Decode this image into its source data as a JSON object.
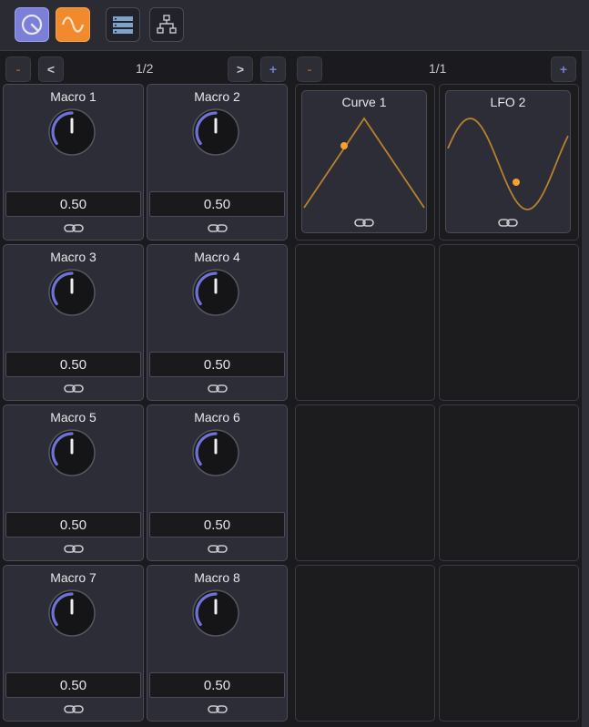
{
  "toolbar": {
    "buttons": [
      {
        "name": "macro-view-button",
        "icon": "knob-icon",
        "active": true
      },
      {
        "name": "lfo-view-button",
        "icon": "wave-icon",
        "active": true
      },
      {
        "name": "list-view-button",
        "icon": "list-icon",
        "active": false
      },
      {
        "name": "tree-view-button",
        "icon": "tree-icon",
        "active": false
      }
    ]
  },
  "macro_panel": {
    "minus": "-",
    "prev": "<",
    "next": ">",
    "plus": "+",
    "page": "1/2",
    "macros": [
      {
        "title": "Macro 1",
        "value": "0.50"
      },
      {
        "title": "Macro 2",
        "value": "0.50"
      },
      {
        "title": "Macro 3",
        "value": "0.50"
      },
      {
        "title": "Macro 4",
        "value": "0.50"
      },
      {
        "title": "Macro 5",
        "value": "0.50"
      },
      {
        "title": "Macro 6",
        "value": "0.50"
      },
      {
        "title": "Macro 7",
        "value": "0.50"
      },
      {
        "title": "Macro 8",
        "value": "0.50"
      }
    ]
  },
  "mod_panel": {
    "minus": "-",
    "plus": "+",
    "page": "1/1",
    "modulators": [
      {
        "title": "Curve 1",
        "shape": "triangle"
      },
      {
        "title": "LFO 2",
        "shape": "sine"
      }
    ]
  },
  "colors": {
    "accent_purple": "#7b7fd8",
    "accent_orange": "#f18a2d",
    "curve_line": "#b5822e",
    "curve_dot": "#f4a12e"
  }
}
